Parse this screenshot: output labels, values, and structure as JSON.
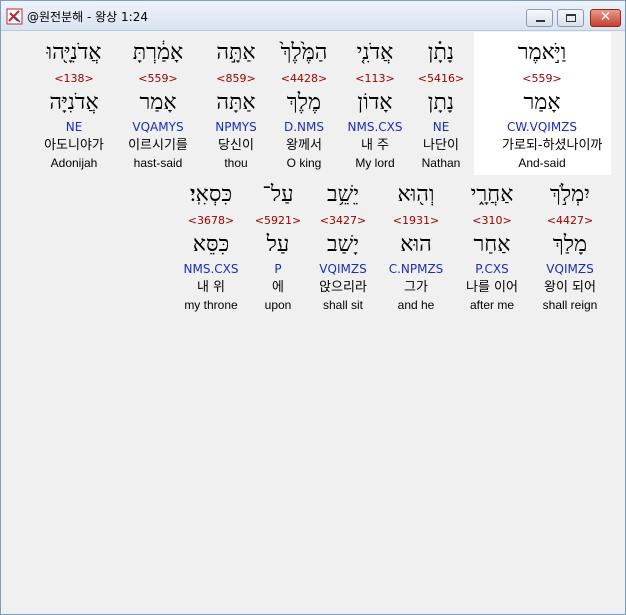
{
  "window": {
    "title": "@원전분해 - 왕상 1:24"
  },
  "controls": {
    "close_glyph": "✕"
  },
  "rows": [
    {
      "words": [
        {
          "hebrew": "וַיֹּ֣אמֶר",
          "strong": "<559>",
          "lemma": "אָמַר",
          "parse": "CW.VQIMZS",
          "korean": "가로되-하셨나이까",
          "english": "And-said"
        },
        {
          "hebrew": "נָתָ֗ן",
          "strong": "<5416>",
          "lemma": "נָתָן",
          "parse": "NE",
          "korean": "나단이",
          "english": "Nathan"
        },
        {
          "hebrew": "אֲדֹנִ֤י",
          "strong": "<113>",
          "lemma": "אָדוֹן",
          "parse": "NMS.CXS",
          "korean": "내 주",
          "english": "My lord"
        },
        {
          "hebrew": "הַמֶּ֙לֶךְ֙",
          "strong": "<4428>",
          "lemma": "מֶלֶךְ",
          "parse": "D.NMS",
          "korean": "왕께서",
          "english": "O king"
        },
        {
          "hebrew": "אַתָּ֣ה",
          "strong": "<859>",
          "lemma": "אַתָּה",
          "parse": "NPMYS",
          "korean": "당신이",
          "english": "thou"
        },
        {
          "hebrew": "אָמַ֔רְתָּ",
          "strong": "<559>",
          "lemma": "אָמַר",
          "parse": "VQAMYS",
          "korean": "이르시기를",
          "english": "hast-said"
        },
        {
          "hebrew": "אֲדֹנִיָּ֖הוּ",
          "strong": "<138>",
          "lemma": "אֲדֹנִיָּה",
          "parse": "NE",
          "korean": "아도니야가",
          "english": "Adonijah"
        }
      ]
    },
    {
      "words": [
        {
          "hebrew": "יִמְלֹ֣ךְ",
          "strong": "<4427>",
          "lemma": "מָלַךְ",
          "parse": "VQIMZS",
          "korean": "왕이 되어",
          "english": "shall reign"
        },
        {
          "hebrew": "אַחֲרָ֑י",
          "strong": "<310>",
          "lemma": "אַחַר",
          "parse": "P.CXS",
          "korean": "나를 이어",
          "english": "after me"
        },
        {
          "hebrew": "וְה֖וּא",
          "strong": "<1931>",
          "lemma": "הוּא",
          "parse": "C.NPMZS",
          "korean": "그가",
          "english": "and he"
        },
        {
          "hebrew": "יֵשֵׁ֥ב",
          "strong": "<3427>",
          "lemma": "יָשַׁב",
          "parse": "VQIMZS",
          "korean": "앉으리라",
          "english": "shall sit"
        },
        {
          "hebrew": "עַל־",
          "strong": "<5921>",
          "lemma": "עַל",
          "parse": "P",
          "korean": "에",
          "english": "upon"
        },
        {
          "hebrew": "כִּסְאִֽי׃",
          "strong": "<3678>",
          "lemma": "כִּסֵּא",
          "parse": "NMS.CXS",
          "korean": "내 위",
          "english": "my throne"
        }
      ]
    }
  ]
}
